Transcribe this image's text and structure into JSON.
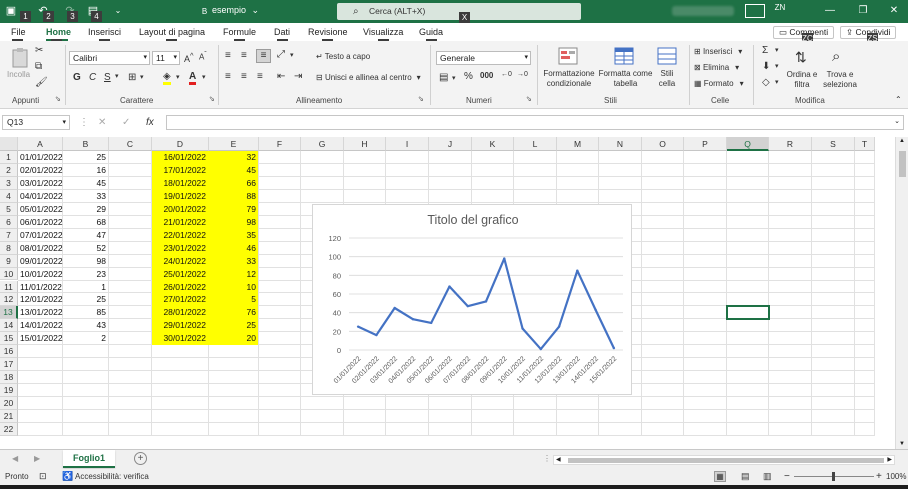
{
  "titlebar": {
    "filename": "esempio",
    "filename_arrow": "⌄",
    "search_placeholder": "Cerca (ALT+X)",
    "user_initials": "ZN",
    "keytips": {
      "qa1": "1",
      "qa2": "2",
      "qa3": "3",
      "qa4": "4",
      "file_marker": "B",
      "search": "X"
    }
  },
  "ribbon_tabs": [
    {
      "label": "File",
      "keytip": "F"
    },
    {
      "label": "Home",
      "keytip": "H"
    },
    {
      "label": "Inserisci",
      "keytip": "C"
    },
    {
      "label": "Layout di pagina",
      "keytip": "P"
    },
    {
      "label": "Formule",
      "keytip": "U"
    },
    {
      "label": "Dati",
      "keytip": "A"
    },
    {
      "label": "Revisione",
      "keytip": "R"
    },
    {
      "label": "Visualizza",
      "keytip": "N"
    },
    {
      "label": "Guida",
      "keytip": "E"
    }
  ],
  "ribbon_right": {
    "comments_label": "Commenti",
    "comments_keytip": "ZC",
    "share_label": "Condividi",
    "share_keytip": "ZS"
  },
  "ribbon": {
    "clipboard": {
      "paste": "Incolla",
      "group": "Appunti"
    },
    "font": {
      "name": "Calibri",
      "size": "11",
      "bold": "G",
      "italic": "C",
      "underline": "S",
      "group": "Carattere"
    },
    "alignment": {
      "wrap": "Testo a capo",
      "merge": "Unisci e allinea al centro",
      "group": "Allineamento"
    },
    "number": {
      "format": "Generale",
      "group": "Numeri"
    },
    "styles": {
      "conditional": "Formattazione condizionale",
      "table": "Formatta come tabella",
      "cell_styles": "Stili cella",
      "group": "Stili"
    },
    "cells": {
      "insert": "Inserisci",
      "delete": "Elimina",
      "format": "Formato",
      "group": "Celle"
    },
    "editing": {
      "sort": "Ordina e filtra",
      "find": "Trova e seleziona",
      "group": "Modifica"
    }
  },
  "formula_bar": {
    "name_box": "Q13",
    "fx": "fx",
    "cancel": "✕",
    "enter": "✓",
    "value": ""
  },
  "columns": [
    "A",
    "B",
    "C",
    "D",
    "E",
    "F",
    "G",
    "H",
    "I",
    "J",
    "K",
    "L",
    "M",
    "N",
    "O",
    "P",
    "Q",
    "R",
    "S",
    "T"
  ],
  "selected_column": "Q",
  "rows": [
    "1",
    "2",
    "3",
    "4",
    "5",
    "6",
    "7",
    "8",
    "9",
    "10",
    "11",
    "12",
    "13",
    "14",
    "15",
    "16",
    "17",
    "18",
    "19",
    "20",
    "21",
    "22"
  ],
  "selected_row": "13",
  "cells": {
    "A": [
      "01/01/2022",
      "02/01/2022",
      "03/01/2022",
      "04/01/2022",
      "05/01/2022",
      "06/01/2022",
      "07/01/2022",
      "08/01/2022",
      "09/01/2022",
      "10/01/2022",
      "11/01/2022",
      "12/01/2022",
      "13/01/2022",
      "14/01/2022",
      "15/01/2022"
    ],
    "B": [
      "25",
      "16",
      "45",
      "33",
      "29",
      "68",
      "47",
      "52",
      "98",
      "23",
      "1",
      "25",
      "85",
      "43",
      "2"
    ],
    "D": [
      "16/01/2022",
      "17/01/2022",
      "18/01/2022",
      "19/01/2022",
      "20/01/2022",
      "21/01/2022",
      "22/01/2022",
      "23/01/2022",
      "24/01/2022",
      "25/01/2022",
      "26/01/2022",
      "27/01/2022",
      "28/01/2022",
      "29/01/2022",
      "30/01/2022"
    ],
    "E": [
      "32",
      "45",
      "66",
      "88",
      "79",
      "98",
      "35",
      "46",
      "33",
      "12",
      "10",
      "5",
      "76",
      "25",
      "20"
    ]
  },
  "highlight_color": "#ffff00",
  "chart_data": {
    "type": "line",
    "title": "Titolo del grafico",
    "categories": [
      "01/01/2022",
      "02/01/2022",
      "03/01/2022",
      "04/01/2022",
      "05/01/2022",
      "06/01/2022",
      "07/01/2022",
      "08/01/2022",
      "09/01/2022",
      "10/01/2022",
      "11/01/2022",
      "12/01/2022",
      "13/01/2022",
      "14/01/2022",
      "15/01/2022"
    ],
    "values": [
      25,
      16,
      45,
      33,
      29,
      68,
      47,
      52,
      98,
      23,
      1,
      25,
      85,
      43,
      2
    ],
    "yticks": [
      "0",
      "20",
      "40",
      "60",
      "80",
      "100",
      "120"
    ],
    "ylim": [
      0,
      120
    ],
    "grid": true,
    "line_color": "#4472c4",
    "xlabel": "",
    "ylabel": ""
  },
  "sheet_tabs": [
    {
      "label": "Foglio1",
      "active": true
    }
  ],
  "add_sheet": "+",
  "status": {
    "ready": "Pronto",
    "accessibility": "Accessibilità: verifica",
    "zoom": "100%",
    "zoom_minus": "−",
    "zoom_plus": "+"
  },
  "accent_color": "#1e7145"
}
